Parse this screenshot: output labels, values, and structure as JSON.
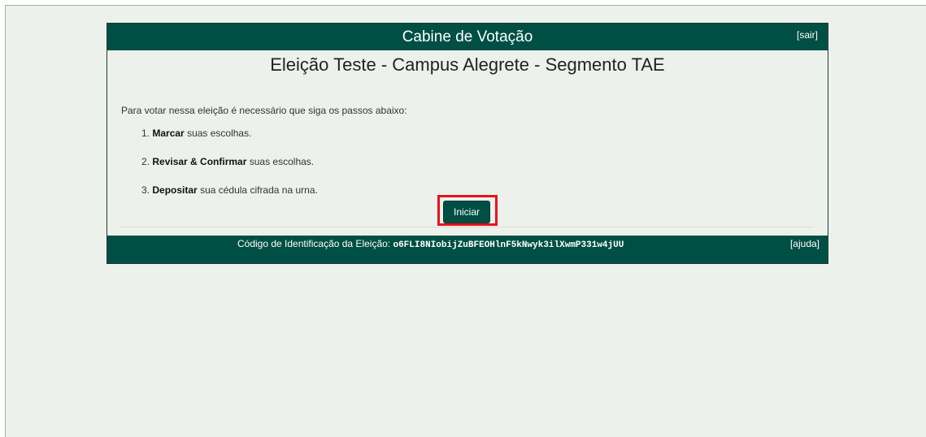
{
  "header": {
    "title": "Cabine de Votação",
    "logout_label": "[sair]"
  },
  "election": {
    "title": "Eleição Teste - Campus Alegrete - Segmento TAE"
  },
  "instructions": {
    "intro": "Para votar nessa eleição é necessário que siga os passos abaixo:",
    "steps": [
      {
        "number": "1.",
        "action": "Marcar",
        "rest": "suas escolhas."
      },
      {
        "number": "2.",
        "action": "Revisar & Confirmar",
        "rest": "suas escolhas."
      },
      {
        "number": "3.",
        "action": "Depositar",
        "rest": "sua cédula cifrada na urna."
      }
    ]
  },
  "actions": {
    "start_label": "Iniciar"
  },
  "footer": {
    "code_label": "Código de Identificação da Eleição:",
    "code_value": "o6FLI8NIobijZuBFEOHlnF5kNwyk3ilXwmP331w4jUU",
    "help_label": "[ajuda]"
  },
  "colors": {
    "primary": "#004f44",
    "background": "#edf1ec",
    "highlight": "#e8121b"
  }
}
